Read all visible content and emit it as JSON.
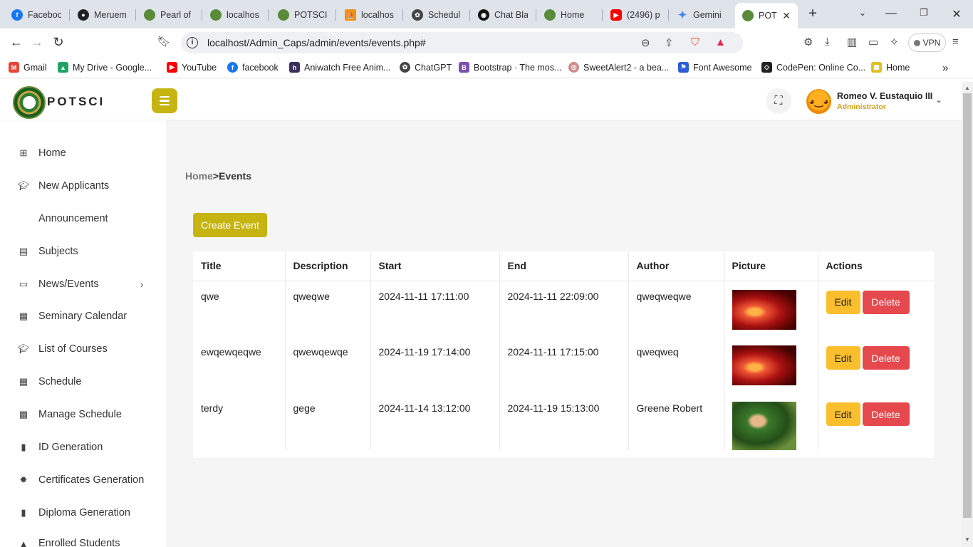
{
  "browser": {
    "tabs": [
      {
        "label": "Faceboo",
        "icon": "facebook-icon",
        "color": "#1877f2"
      },
      {
        "label": "Meruem",
        "icon": "github-icon",
        "color": "#222222"
      },
      {
        "label": "Pearl of",
        "icon": "globe-icon",
        "color": "#5a8a3a"
      },
      {
        "label": "localhos",
        "icon": "globe-icon",
        "color": "#5a8a3a"
      },
      {
        "label": "POTSCI",
        "icon": "globe-icon",
        "color": "#5a8a3a"
      },
      {
        "label": "localhos",
        "icon": "phpmyadmin-icon",
        "color": "#f29111"
      },
      {
        "label": "Schedul",
        "icon": "chatgpt-icon",
        "color": "#444444"
      },
      {
        "label": "Chat Bla",
        "icon": "chat-icon",
        "color": "#111111"
      },
      {
        "label": "Home",
        "icon": "globe-icon",
        "color": "#5a8a3a"
      },
      {
        "label": "(2496) p",
        "icon": "youtube-icon",
        "color": "#ff0000"
      },
      {
        "label": "Gemini",
        "icon": "gemini-icon",
        "color": "#4285f4"
      },
      {
        "label": "POT",
        "icon": "globe-icon",
        "color": "#5a8a3a"
      }
    ],
    "url": "localhost/Admin_Caps/admin/events/events.php#",
    "vpn_label": "VPN",
    "bookmarks": [
      {
        "label": "Gmail",
        "color": "#ea4335",
        "glyph": "M"
      },
      {
        "label": "My Drive - Google...",
        "color": "#1fa463",
        "glyph": "▲"
      },
      {
        "label": "YouTube",
        "color": "#ff0000",
        "glyph": "▶"
      },
      {
        "label": "facebook",
        "color": "#1877f2",
        "glyph": "f"
      },
      {
        "label": "Aniwatch Free Anim...",
        "color": "#3b2f5e",
        "glyph": "h"
      },
      {
        "label": "ChatGPT",
        "color": "#444444",
        "glyph": "✿"
      },
      {
        "label": "Bootstrap · The mos...",
        "color": "#7952b3",
        "glyph": "B"
      },
      {
        "label": "SweetAlert2 - a bea...",
        "color": "#d08a8a",
        "glyph": "◎"
      },
      {
        "label": "Font Awesome",
        "color": "#2a5fd6",
        "glyph": "⚑"
      },
      {
        "label": "CodePen: Online Co...",
        "color": "#222222",
        "glyph": "◇"
      },
      {
        "label": "Home",
        "color": "#e0c020",
        "glyph": "▣"
      }
    ]
  },
  "app": {
    "brand": "POTSCI",
    "user": {
      "name": "Romeo V. Eustaquio III",
      "role": "Administrator"
    },
    "sidebar": [
      {
        "label": "Home",
        "icon": "grid-icon"
      },
      {
        "label": "New Applicants",
        "icon": "graduation-cap-icon"
      },
      {
        "label": "Announcement",
        "icon": ""
      },
      {
        "label": "Subjects",
        "icon": "book-icon"
      },
      {
        "label": "News/Events",
        "icon": "newspaper-icon",
        "chevron": true
      },
      {
        "label": "Seminary Calendar",
        "icon": "calendar-icon"
      },
      {
        "label": "List of Courses",
        "icon": "graduation-cap-icon"
      },
      {
        "label": "Schedule",
        "icon": "calendar-icon"
      },
      {
        "label": "Manage Schedule",
        "icon": "chalkboard-user-icon"
      },
      {
        "label": "ID Generation",
        "icon": "file-icon"
      },
      {
        "label": "Certificates Generation",
        "icon": "certificate-icon"
      },
      {
        "label": "Diploma Generation",
        "icon": "file-icon"
      },
      {
        "label": "Enrolled Students",
        "icon": "users-icon"
      }
    ],
    "breadcrumb": {
      "home": "Home",
      "separator": ">",
      "current": "Events"
    },
    "create_button": "Create Event",
    "table": {
      "headers": [
        "Title",
        "Description",
        "Start",
        "End",
        "Author",
        "Picture",
        "Actions"
      ],
      "rows": [
        {
          "title": "qwe",
          "description": "qweqwe",
          "start": "2024-11-11 17:11:00",
          "end": "2024-11-11 22:09:00",
          "author": "qweqweqwe",
          "picture": "fire-dragon-image"
        },
        {
          "title": "ewqewqeqwe",
          "description": "qwewqewqe",
          "start": "2024-11-19 17:14:00",
          "end": "2024-11-11 17:15:00",
          "author": "qweqweq",
          "picture": "fire-dragon-image"
        },
        {
          "title": "terdy",
          "description": "gege",
          "start": "2024-11-14 13:12:00",
          "end": "2024-11-19 15:13:00",
          "author": "Greene Robert",
          "picture": "kid-photo-image"
        }
      ],
      "edit_label": "Edit",
      "delete_label": "Delete"
    },
    "colors": {
      "accent": "#c5b411",
      "edit": "#fbbf2e",
      "delete": "#e5484d",
      "role": "#d4a017"
    }
  }
}
